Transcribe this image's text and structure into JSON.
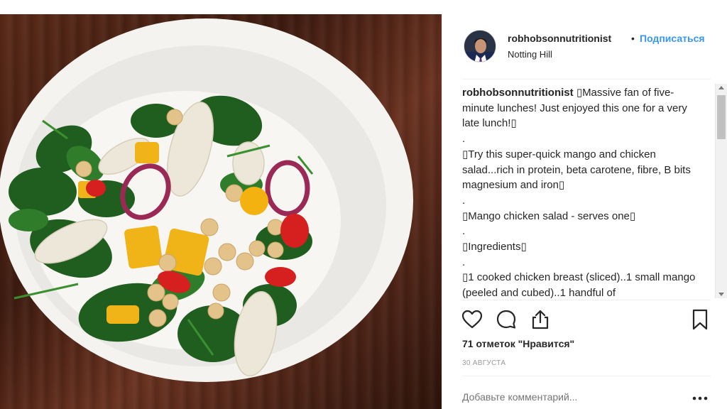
{
  "post": {
    "image_alt": "Mango chicken salad in a white bowl on a wooden table",
    "author": {
      "username": "robhobsonnutritionist",
      "separator": "•",
      "follow_label": "Подписаться",
      "location": "Notting Hill"
    },
    "caption": {
      "username": "robhobsonnutritionist",
      "lines": [
        "▯Massive fan of five-minute lunches! Just enjoyed this one for a very late lunch!▯",
        ".",
        "▯Try this super-quick mango and chicken salad...rich in protein, beta carotene, fibre, B bits magnesium and iron▯",
        ".",
        "▯Mango chicken salad - serves one▯",
        ".",
        "▯Ingredients▯",
        ".",
        "▯1 cooked chicken breast (sliced)..1 small mango (peeled and cubed)..1 handful of"
      ]
    },
    "likes_text": "71 отметок \"Нравится\"",
    "date_text": "30 АВГУСТА",
    "comment_placeholder": "Добавьте комментарий..."
  },
  "icons": {
    "like": "heart-icon",
    "comment": "comment-icon",
    "share": "share-icon",
    "save": "bookmark-icon",
    "more": "more-options-icon"
  },
  "colors": {
    "follow": "#3897f0",
    "text": "#262626",
    "muted": "#999999"
  }
}
